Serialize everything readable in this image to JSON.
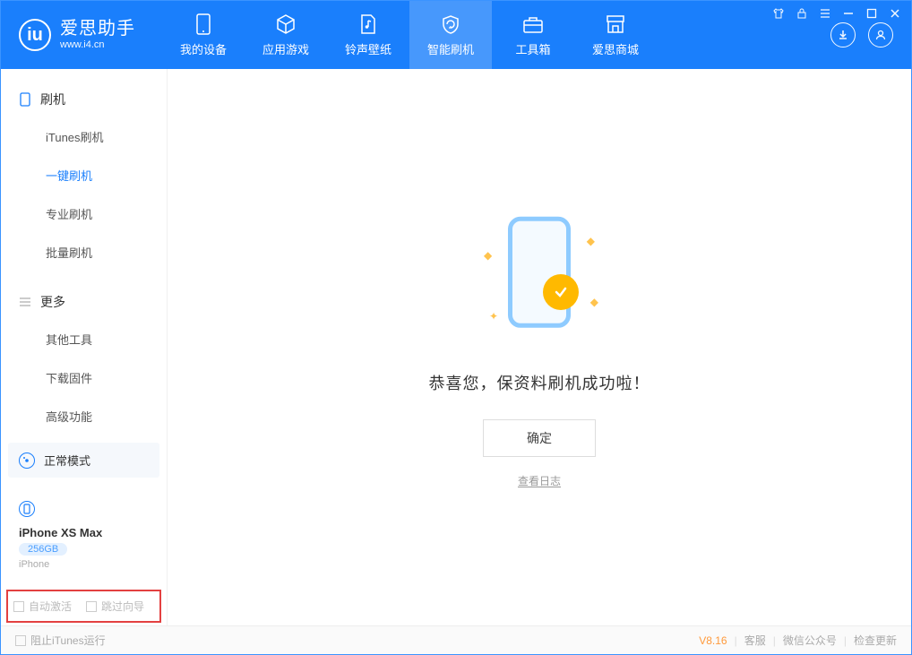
{
  "app": {
    "name": "爱思助手",
    "domain": "www.i4.cn"
  },
  "tabs": [
    {
      "label": "我的设备"
    },
    {
      "label": "应用游戏"
    },
    {
      "label": "铃声壁纸"
    },
    {
      "label": "智能刷机"
    },
    {
      "label": "工具箱"
    },
    {
      "label": "爱思商城"
    }
  ],
  "sidebar": {
    "section1": {
      "title": "刷机",
      "items": [
        {
          "label": "iTunes刷机"
        },
        {
          "label": "一键刷机"
        },
        {
          "label": "专业刷机"
        },
        {
          "label": "批量刷机"
        }
      ]
    },
    "section2": {
      "title": "更多",
      "items": [
        {
          "label": "其他工具"
        },
        {
          "label": "下载固件"
        },
        {
          "label": "高级功能"
        }
      ]
    },
    "mode_label": "正常模式",
    "device": {
      "name": "iPhone XS Max",
      "storage": "256GB",
      "type": "iPhone"
    },
    "options": {
      "auto_activate": "自动激活",
      "skip_guide": "跳过向导"
    }
  },
  "main": {
    "success_text": "恭喜您，保资料刷机成功啦！",
    "confirm_button": "确定",
    "view_log": "查看日志"
  },
  "footer": {
    "prevent_itunes": "阻止iTunes运行",
    "version": "V8.16",
    "links": {
      "customer_service": "客服",
      "wechat": "微信公众号",
      "check_update": "检查更新"
    }
  }
}
